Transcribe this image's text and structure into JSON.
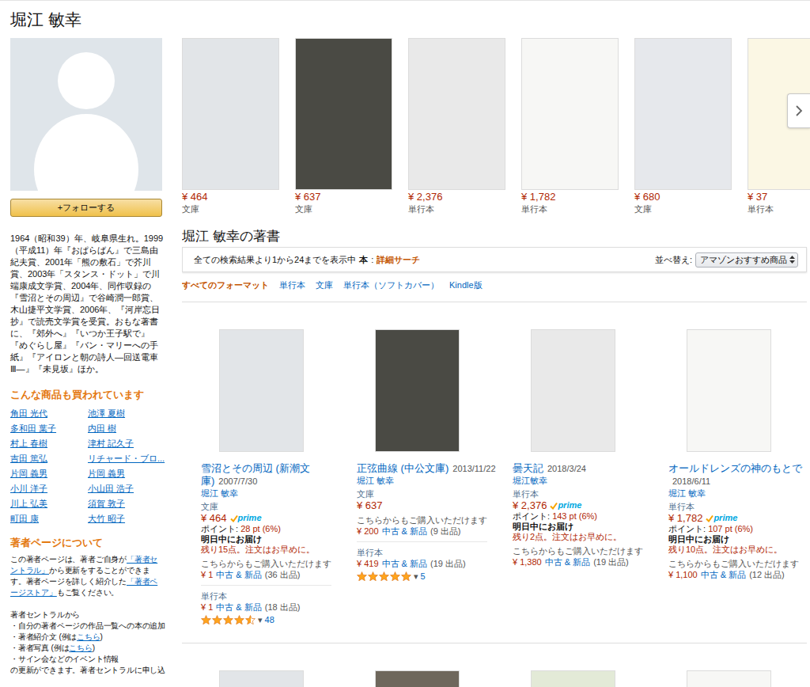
{
  "author": {
    "name": "堀江 敏幸",
    "follow_button": "+フォローする",
    "bio": "1964（昭和39）年、岐阜県生れ。1999（平成11）年『おぱらばん』で三島由紀夫賞、2001年「熊の敷石」で芥川賞、2003年「スタンス・ドット」で川端康成文学賞、2004年、同作収録の『雪沼とその周辺』で谷崎潤一郎賞、木山捷平文学賞、2006年、『河岸忘日抄』で読売文学賞を受賞。おもな著書に、『郊外へ』『いつか王子駅で』『めぐらし屋』『バン・マリーへの手紙』『アイロンと朝の詩人―回送電車Ⅲ―』『未見坂』ほか。"
  },
  "also_bought": {
    "heading": "こんな商品も買われています",
    "authors": [
      "角田 光代",
      "池澤 夏樹",
      "多和田 葉子",
      "内田 樹",
      "村上 春樹",
      "津村 記久子",
      "吉田 篤弘",
      "リチャード・ブロ...",
      "片岡 義男",
      "片岡 義男",
      "小川 洋子",
      "小山田 浩子",
      "川上 弘美",
      "須賀 敦子",
      "町田 康",
      "大竹 昭子"
    ]
  },
  "about": {
    "heading": "著者ページについて",
    "paragraphs": [
      [
        [
          {
            "text": "この著者ページは、著者ご自身が",
            "link": false
          },
          {
            "text": "「著者セントラル」",
            "link": true
          },
          {
            "text": "から更新をすることができます。著者ページを詳しく紹介した",
            "link": false
          },
          {
            "text": "「著者ページストア」",
            "link": true
          },
          {
            "text": "もご覧ください。",
            "link": false
          }
        ]
      ],
      [
        [
          {
            "text": "著者セントラルから",
            "link": false
          }
        ],
        [
          {
            "text": "・自分の著者ページの作品一覧への本の追加",
            "link": false
          }
        ],
        [
          {
            "text": "・著者紹介文 (例は",
            "link": false
          },
          {
            "text": "こちら",
            "link": true
          },
          {
            "text": ")",
            "link": false
          }
        ],
        [
          {
            "text": "・著者写真 (例は",
            "link": false
          },
          {
            "text": "こちら",
            "link": true
          },
          {
            "text": ")",
            "link": false
          }
        ],
        [
          {
            "text": "・サイン会などのイベント情報",
            "link": false
          }
        ],
        [
          {
            "text": "の更新ができます。著者セントラルに申し込",
            "link": false
          }
        ]
      ]
    ]
  },
  "carousel": {
    "items": [
      {
        "price": "¥ 464",
        "format": "文庫",
        "color": "#e2e5e8"
      },
      {
        "price": "¥ 637",
        "format": "文庫",
        "color": "#4a4a44"
      },
      {
        "price": "¥ 2,376",
        "format": "単行本",
        "color": "#e9e9e9"
      },
      {
        "price": "¥ 1,782",
        "format": "単行本",
        "color": "#f7f7f5"
      },
      {
        "price": "¥ 680",
        "format": "文庫",
        "color": "#e6e8ec"
      },
      {
        "price": "¥ 37",
        "format": "単行本",
        "color": "#fbf7e4"
      }
    ]
  },
  "books_section": {
    "heading": "堀江 敏幸の著書",
    "results_text": "全ての検索結果より1から24までを表示中",
    "category": "本",
    "separator": ":",
    "advanced_search": "詳細サーチ",
    "sort_label": "並べ替え:",
    "sort_value": "アマゾンおすすめ商品"
  },
  "format_filters": [
    {
      "label": "すべてのフォーマット",
      "selected": true
    },
    {
      "label": "単行本",
      "selected": false
    },
    {
      "label": "文庫",
      "selected": false
    },
    {
      "label": "単行本（ソフトカバー）",
      "selected": false
    },
    {
      "label": "Kindle版",
      "selected": false
    }
  ],
  "prime_label": "prime",
  "rating_caret": "▾",
  "products": [
    {
      "title": "雪沼とその周辺 (新潮文庫)",
      "date": "2007/7/30",
      "author": "堀江 敏幸",
      "color": "#e2e5e8",
      "offers": [
        {
          "format": "文庫",
          "price": "¥ 464",
          "prime": true,
          "points_label": "ポイント:",
          "points_value": "28 pt (6%)",
          "delivery": "明日中にお届け",
          "stock": "残り15点。注文はお早めに。",
          "other_label": "こちらからもご購入いただけます",
          "used_price": "¥ 1",
          "used_link": "中古 & 新品",
          "used_count": "(36 出品)"
        },
        {
          "format": "単行本",
          "used_price": "¥ 1",
          "used_link": "中古 & 新品",
          "used_count": "(18 出品)",
          "stars": 4.5,
          "rating_count": "48"
        }
      ]
    },
    {
      "title": "正弦曲線 (中公文庫)",
      "date": "2013/11/22",
      "author": "堀江 敏幸",
      "color": "#4a4a44",
      "offers": [
        {
          "format": "文庫",
          "price": "¥ 637",
          "prime": false,
          "other_label": "こちらからもご購入いただけます",
          "used_price": "¥ 200",
          "used_link": "中古 & 新品",
          "used_count": "(9 出品)"
        },
        {
          "format": "単行本",
          "used_price": "¥ 419",
          "used_link": "中古 & 新品",
          "used_count": "(19 出品)",
          "stars": 5,
          "rating_count": "5"
        }
      ]
    },
    {
      "title": "曇天記",
      "date": "2018/3/24",
      "author": "堀江敏幸",
      "color": "#e9e9e9",
      "offers": [
        {
          "format": "単行本",
          "price": "¥ 2,376",
          "prime": true,
          "points_label": "ポイント:",
          "points_value": "143 pt (6%)",
          "delivery": "明日中にお届け",
          "stock": "残り2点。注文はお早めに。",
          "other_label": "こちらからもご購入いただけます",
          "used_price": "¥ 1,380",
          "used_link": "中古 & 新品",
          "used_count": "(19 出品)"
        }
      ]
    },
    {
      "title": "オールドレンズの神のもとで",
      "date": "2018/6/11",
      "author": "堀江 敏幸",
      "color": "#f7f7f5",
      "offers": [
        {
          "format": "単行本",
          "price": "¥ 1,782",
          "prime": true,
          "points_label": "ポイント:",
          "points_value": "107 pt (6%)",
          "delivery": "明日中にお届け",
          "stock": "残り10点。注文はお早めに。",
          "other_label": "こちらからもご購入いただけます",
          "used_price": "¥ 1,100",
          "used_link": "中古 & 新品",
          "used_count": "(12 出品)"
        }
      ]
    }
  ],
  "more_covers": [
    {
      "color": "#e2e5e8"
    },
    {
      "color": "#6e675c"
    },
    {
      "color": "#e3ead7"
    },
    {
      "color": "#f7f7f5"
    }
  ]
}
